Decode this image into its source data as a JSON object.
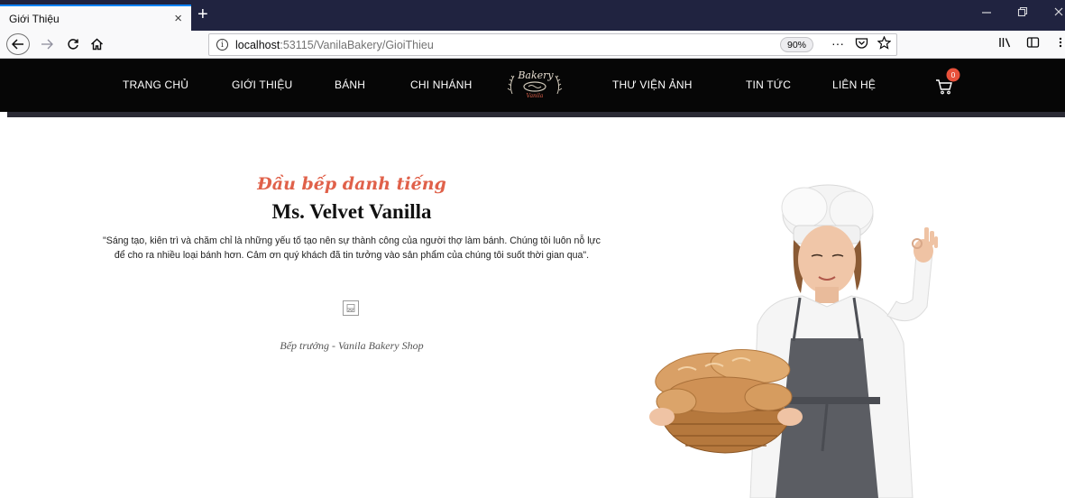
{
  "browser": {
    "tab_title": "Giới Thiệu",
    "tab_close": "×",
    "new_tab": "+",
    "url_host": "localhost",
    "url_path": ":53115/VanilaBakery/GioiThieu",
    "zoom": "90%",
    "page_actions": "···"
  },
  "site": {
    "menu": {
      "home": "TRANG CHỦ",
      "about": "GIỚI THIỆU",
      "cakes": "BÁNH",
      "branches": "CHI NHÁNH",
      "gallery": "THƯ VIỆN ẢNH",
      "news": "TIN TỨC",
      "contact": "LIÊN HỆ"
    },
    "logo": {
      "script": "Bakery",
      "sub": "Vanila"
    },
    "cart_count": "0"
  },
  "content": {
    "subtitle": "Đầu bếp danh tiếng",
    "name": "Ms. Velvet Vanilla",
    "quote": "\"Sáng tạo, kiên trì và chăm chỉ là những yếu tố tạo nên sự thành công của người thợ làm bánh. Chúng tôi luôn nỗ lực để cho ra nhiều loại bánh hơn. Cảm ơn quý khách đã tin tưởng vào sản phẩm của chúng tôi suốt thời gian qua\".",
    "role": "Bếp trưởng - Vanila Bakery Shop"
  },
  "colors": {
    "accent": "#e0614a",
    "header_bg": "#060606",
    "tabbar_bg": "#202340",
    "badge": "#e8513b"
  }
}
